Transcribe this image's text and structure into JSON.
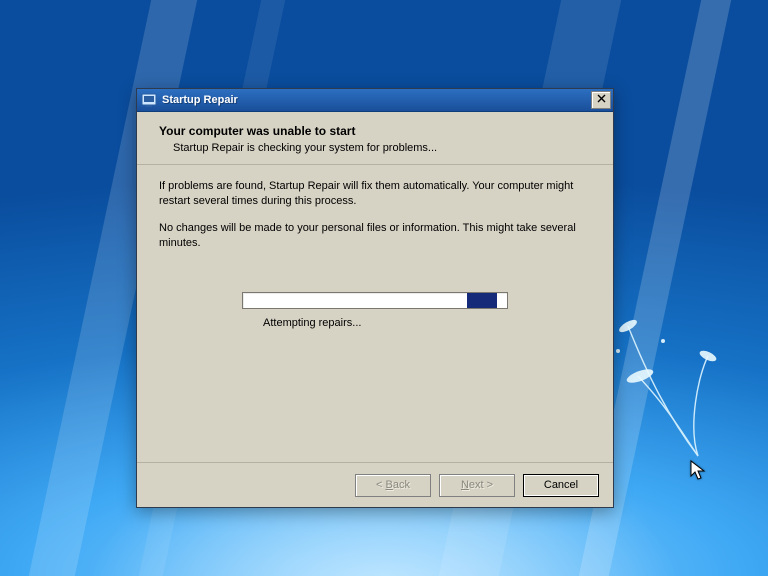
{
  "window": {
    "title": "Startup Repair",
    "icon_name": "startup-repair-icon"
  },
  "header": {
    "title": "Your computer was unable to start",
    "subtitle": "Startup Repair is checking your system for problems..."
  },
  "body": {
    "line1": "If problems are found, Startup Repair will fix them automatically. Your computer might restart several times during this process.",
    "line2": "No changes will be made to your personal files or information. This might take several minutes."
  },
  "progress": {
    "label": "Attempting repairs...",
    "indeterminate": true
  },
  "buttons": {
    "back_prefix": "< ",
    "back_letter": "B",
    "back_rest": "ack",
    "next_letter": "N",
    "next_rest": "ext >",
    "cancel": "Cancel",
    "back_enabled": false,
    "next_enabled": false,
    "cancel_enabled": true
  }
}
